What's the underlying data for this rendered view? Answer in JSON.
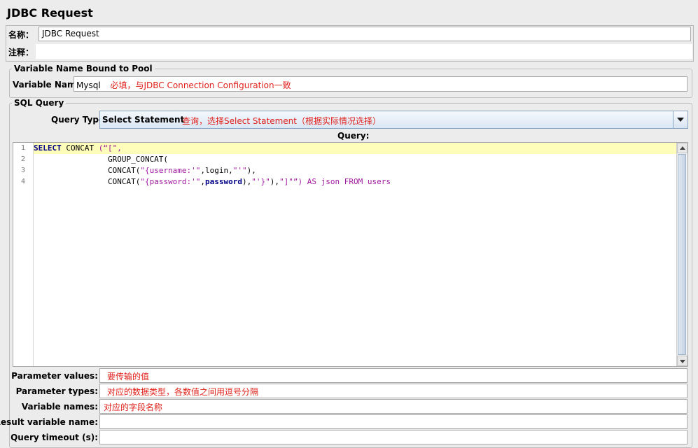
{
  "title": "JDBC Request",
  "name_field": {
    "label": "名称：",
    "value": "JDBC Request"
  },
  "comment_field": {
    "label": "注释：",
    "value": ""
  },
  "pool_group": {
    "legend": "Variable Name Bound to Pool",
    "label": "Variable Name:",
    "value": "Mysql",
    "note": "必填，与JDBC Connection Configuration一致"
  },
  "sql_group": {
    "legend": "SQL Query",
    "query_type_label": "Query Type:",
    "query_type_value": "Select Statement",
    "query_type_note": "查询，选择Select Statement（根据实际情况选择）",
    "query_label": "Query:",
    "line_numbers": [
      "1",
      "2",
      "3",
      "4"
    ],
    "code_lines": [
      [
        {
          "t": "SELECT",
          "c": "kw"
        },
        {
          "t": " CONCAT ",
          "c": "fn"
        },
        {
          "t": "(“[\",",
          "c": "str"
        }
      ],
      [
        {
          "t": "                GROUP_CONCAT(",
          "c": "fn"
        }
      ],
      [
        {
          "t": "                CONCAT(",
          "c": "fn"
        },
        {
          "t": "\"{username:'\"",
          "c": "str"
        },
        {
          "t": ",login,",
          "c": "plain"
        },
        {
          "t": "\"'\"",
          "c": "str"
        },
        {
          "t": "),",
          "c": "plain"
        }
      ],
      [
        {
          "t": "                CONCAT(",
          "c": "fn"
        },
        {
          "t": "\"{password:'\"",
          "c": "str"
        },
        {
          "t": ",",
          "c": "plain"
        },
        {
          "t": "password",
          "c": "kw"
        },
        {
          "t": "),",
          "c": "plain"
        },
        {
          "t": "\"'}\"",
          "c": "str"
        },
        {
          "t": "),",
          "c": "plain"
        },
        {
          "t": "\"]\"",
          "c": "str"
        },
        {
          "t": "”) AS json FROM users",
          "c": "str"
        }
      ]
    ]
  },
  "params": [
    {
      "label": "Parameter values:",
      "note": "要传输的值"
    },
    {
      "label": "Parameter types:",
      "note": "对应的数据类型，各数值之间用逗号分隔"
    },
    {
      "label": "Variable names:",
      "note": "对应的字段名称"
    },
    {
      "label": "Result variable name:",
      "note": ""
    },
    {
      "label": "Query timeout (s):",
      "note": ""
    }
  ]
}
